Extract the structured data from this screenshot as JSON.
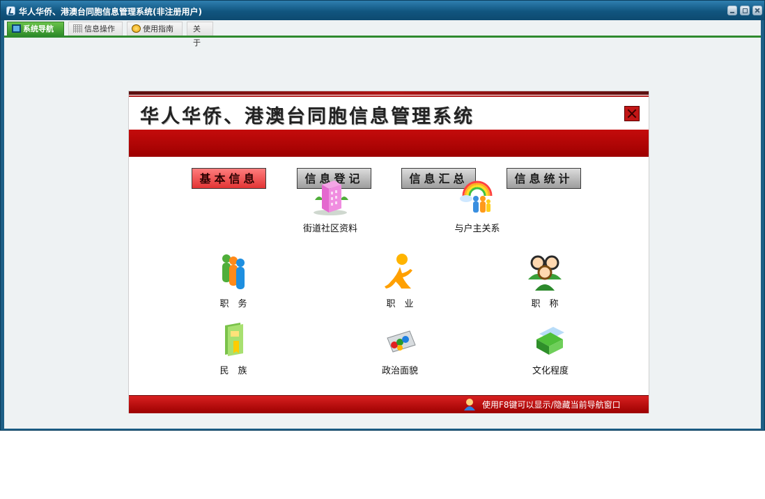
{
  "window": {
    "title": "华人华侨、港澳台同胞信息管理系统(非注册用户)"
  },
  "tabs": [
    {
      "label": "系统导航",
      "icon": "monitor-icon",
      "active": true
    },
    {
      "label": "信息操作",
      "icon": "grid-icon"
    },
    {
      "label": "使用指南",
      "icon": "smile-icon"
    },
    {
      "label": "关于"
    }
  ],
  "panel": {
    "title": "华人华侨、港澳台同胞信息管理系统",
    "nav": [
      "基本信息",
      "信息登记",
      "信息汇总",
      "信息统计"
    ],
    "items": [
      {
        "label": "街道社区资料",
        "icon": "building-icon"
      },
      {
        "label": "与户主关系",
        "icon": "family-rainbow-icon"
      },
      {
        "label": "职　务",
        "icon": "people-group-icon"
      },
      {
        "label": "职　业",
        "icon": "running-person-icon"
      },
      {
        "label": "职　称",
        "icon": "users-icon"
      },
      {
        "label": "民　族",
        "icon": "book-icon"
      },
      {
        "label": "政治面貌",
        "icon": "puzzle-icon"
      },
      {
        "label": "文化程度",
        "icon": "folder-icon"
      }
    ],
    "footer_hint": "使用F8键可以显示/隐藏当前导航窗口"
  }
}
